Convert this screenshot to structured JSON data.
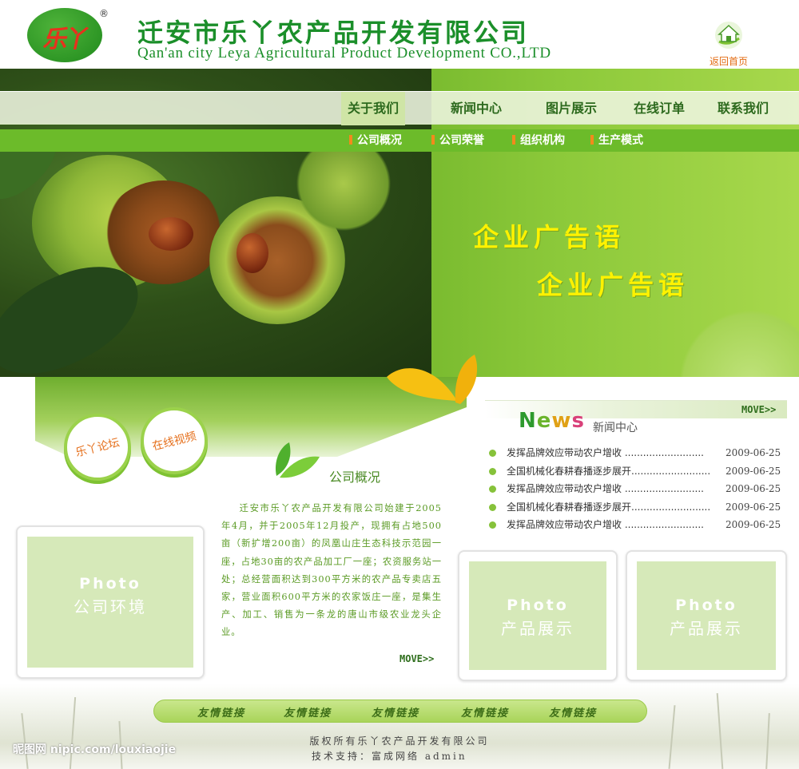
{
  "header": {
    "logo_mark": "乐丫",
    "registered_mark": "®",
    "company_name_cn": "迁安市乐丫农产品开发有限公司",
    "company_name_en": "Qan'an city Leya Agricultural Product Development CO.,LTD",
    "home_label": "返回首页",
    "home_icon": "house-icon"
  },
  "nav": {
    "items": [
      {
        "label": "关于我们",
        "active": true
      },
      {
        "label": "新闻中心",
        "active": false
      },
      {
        "label": "图片展示",
        "active": false
      },
      {
        "label": "在线订单",
        "active": false
      },
      {
        "label": "联系我们",
        "active": false
      }
    ]
  },
  "subnav": {
    "items": [
      "公司概况",
      "公司荣誉",
      "组织机构",
      "生产模式"
    ]
  },
  "hero": {
    "slogan_1": "企业广告语",
    "slogan_2": "企业广告语"
  },
  "quick_links": {
    "forum": "乐丫论坛",
    "video": "在线视频"
  },
  "about": {
    "title": "公司概况",
    "body": "迁安市乐丫农产品开发有限公司始建于2005年4月，并于2005年12月投产，现拥有占地500亩（新扩增200亩）的凤凰山庄生态科技示范园一座，占地30亩的农产品加工厂一座；农资服务站一处；总经营面积达到300平方米的农产品专卖店五家，营业面积600平方米的农家饭庄一座，是集生产、加工、销售为一条龙的唐山市级农业龙头企业。",
    "more": "MOVE>>"
  },
  "news": {
    "word": [
      "N",
      "e",
      "w",
      "s"
    ],
    "word_colors": [
      "#2e9a2e",
      "#6ab42c",
      "#e0a116",
      "#d9417a"
    ],
    "title_cn": "新闻中心",
    "more": "MOVE>>",
    "items": [
      {
        "title": "发挥品牌效应带动农户增收 ..........................",
        "date": "2009-06-25"
      },
      {
        "title": "全国机械化春耕春播逐步展开..........................",
        "date": "2009-06-25"
      },
      {
        "title": "发挥品牌效应带动农户增收 ..........................",
        "date": "2009-06-25"
      },
      {
        "title": "全国机械化春耕春播逐步展开..........................",
        "date": "2009-06-25"
      },
      {
        "title": "发挥品牌效应带动农户增收 ..........................",
        "date": "2009-06-25"
      }
    ]
  },
  "photos": [
    {
      "en": "Photo",
      "cn": "公司环境"
    },
    {
      "en": "Photo",
      "cn": "产品展示"
    },
    {
      "en": "Photo",
      "cn": "产品展示"
    }
  ],
  "footer": {
    "links": [
      "友情链接",
      "友情链接",
      "友情链接",
      "友情链接",
      "友情链接"
    ],
    "copyright": "版权所有乐丫农产品开发有限公司",
    "tech_support": "技术支持：富成网络     admin",
    "watermark": "昵图网 nipic.com/louxiaojie"
  },
  "colors": {
    "brand_green": "#1b8f2a",
    "slogan_yellow": "#fff200",
    "accent_orange": "#e36b12"
  }
}
